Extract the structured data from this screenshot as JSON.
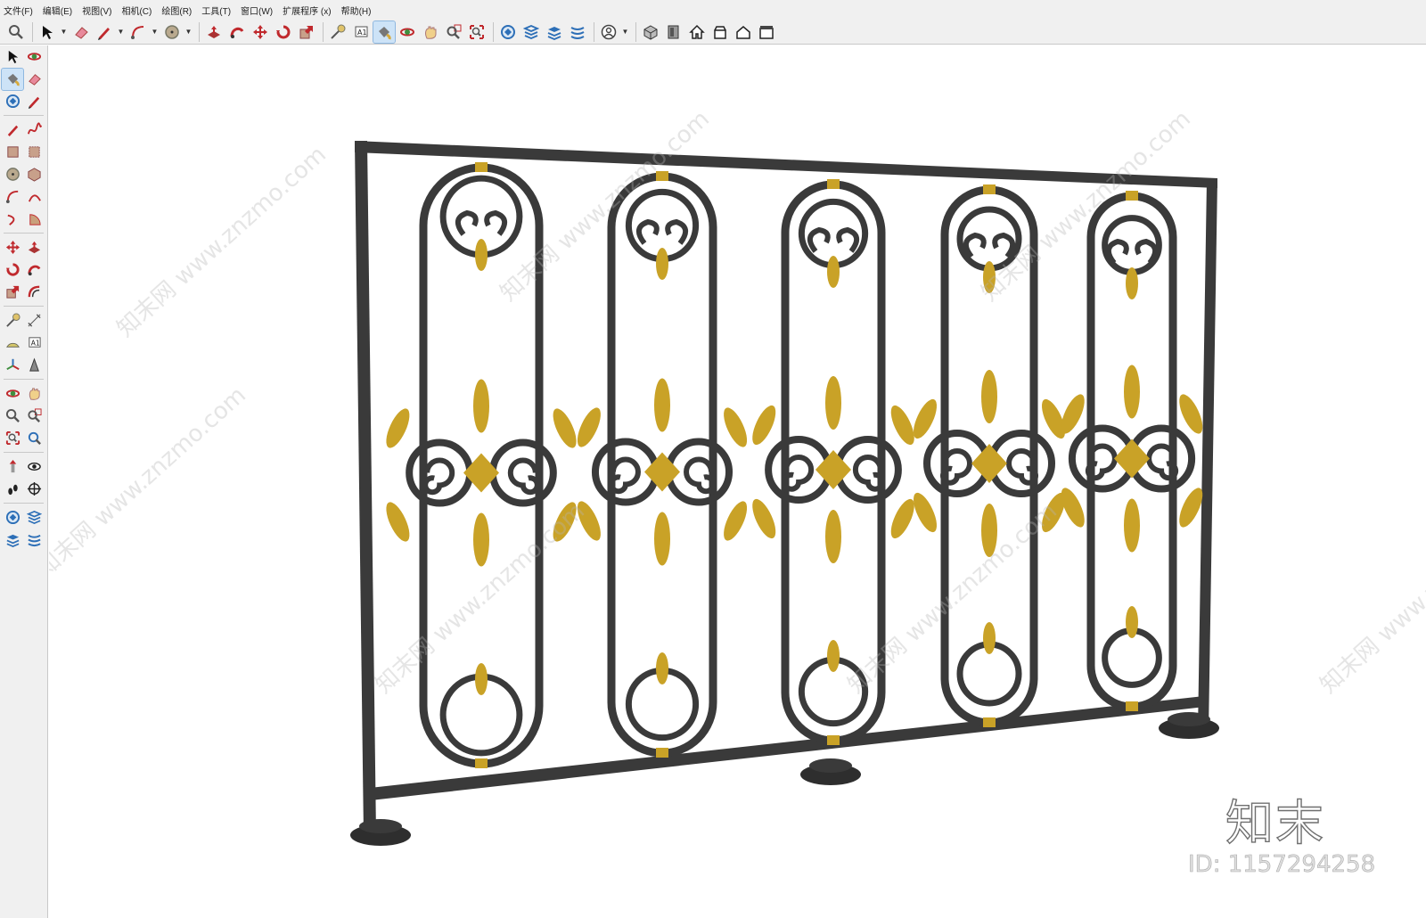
{
  "menu": [
    "文件(F)",
    "编辑(E)",
    "视图(V)",
    "相机(C)",
    "绘图(R)",
    "工具(T)",
    "窗口(W)",
    "扩展程序 (x)",
    "帮助(H)"
  ],
  "colors": {
    "iron": "#3a3a3a",
    "gold": "#c9a227",
    "toolbar_bg": "#f0f0f0",
    "viewport_bg": "#ffffff"
  },
  "top_toolbar": [
    {
      "icon": "zoom-icon"
    },
    {
      "icon": "select-arrow-icon",
      "caret": true
    },
    {
      "icon": "eraser-icon"
    },
    {
      "icon": "pencil-icon",
      "caret": true
    },
    {
      "icon": "arc-icon",
      "caret": true
    },
    {
      "icon": "circle-icon",
      "caret": true
    },
    {
      "icon": "push-pull-icon"
    },
    {
      "icon": "follow-me-icon"
    },
    {
      "icon": "move-icon"
    },
    {
      "icon": "rotate-icon"
    },
    {
      "icon": "scale-icon"
    },
    {
      "icon": "tape-measure-icon"
    },
    {
      "icon": "text-icon"
    },
    {
      "icon": "paint-bucket-icon",
      "active": true
    },
    {
      "icon": "orbit-icon"
    },
    {
      "icon": "pan-icon"
    },
    {
      "icon": "zoom-window-icon"
    },
    {
      "icon": "zoom-extents-icon"
    },
    {
      "icon": "warehouse-icon"
    },
    {
      "icon": "layers-icon"
    },
    {
      "icon": "stack-icon"
    },
    {
      "icon": "sandbox-icon"
    },
    {
      "icon": "account-icon",
      "caret": true
    },
    {
      "icon": "iso-view-icon"
    },
    {
      "icon": "component-icon"
    },
    {
      "icon": "home-icon"
    },
    {
      "icon": "front-view-icon"
    },
    {
      "icon": "house-icon"
    },
    {
      "icon": "box-view-icon"
    }
  ],
  "left_toolbar": [
    [
      "select-arrow-icon",
      "orbit-icon"
    ],
    [
      "paint-bucket-icon",
      "eraser-icon"
    ],
    [
      "warehouse-icon",
      "pencil-icon"
    ],
    [
      "line-icon",
      "freehand-icon"
    ],
    [
      "rectangle-icon",
      "rotated-rect-icon"
    ],
    [
      "circle-icon",
      "polygon-icon"
    ],
    [
      "arc-icon",
      "two-point-arc-icon"
    ],
    [
      "three-point-arc-icon",
      "pie-icon"
    ],
    [
      "move-icon",
      "push-pull-icon"
    ],
    [
      "rotate-icon",
      "follow-me-icon"
    ],
    [
      "scale-icon",
      "offset-icon"
    ],
    [
      "tape-measure-icon",
      "dimension-icon"
    ],
    [
      "protractor-icon",
      "text-icon"
    ],
    [
      "axes-icon",
      "3d-text-icon"
    ],
    [
      "orbit-icon",
      "pan-icon"
    ],
    [
      "zoom-icon",
      "zoom-window-icon"
    ],
    [
      "zoom-extents-icon",
      "previous-view-icon"
    ],
    [
      "position-camera-icon",
      "look-around-icon"
    ],
    [
      "walk-icon",
      "section-plane-icon"
    ],
    [
      "warehouse-icon",
      "layers-icon"
    ],
    [
      "stack-icon",
      "sandbox-icon"
    ]
  ],
  "scene": {
    "watermark": "知末网 www.znzmo.com",
    "brand": "知末",
    "brand_id": "ID: 1157294258"
  }
}
